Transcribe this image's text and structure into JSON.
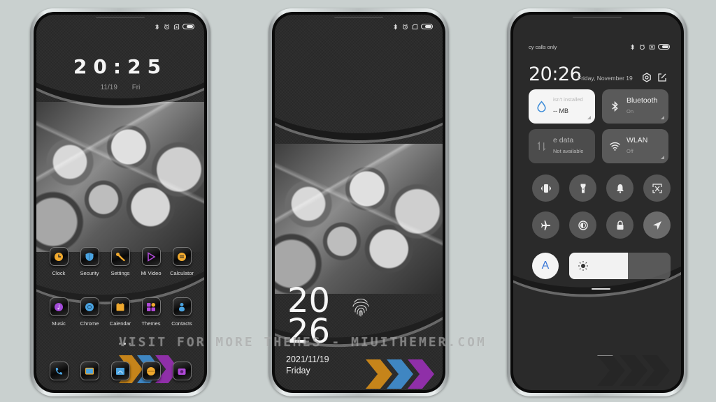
{
  "colors": {
    "background": "#c9d0cf",
    "chevron_orange": "#c6841a",
    "chevron_blue": "#3f86c2",
    "chevron_purple": "#8f2fa8",
    "accent_blue": "#3b78d8"
  },
  "watermark": "VISIT FOR MORE THEMES - MIUITHEMER.COM",
  "home_screen": {
    "status_icons": [
      "bluetooth-icon",
      "alarm-icon",
      "sim-icon",
      "battery-icon"
    ],
    "clock": "20:25",
    "date": "11/19",
    "weekday": "Fri",
    "apps_row1": [
      {
        "label": "Clock",
        "icon": "clock-icon",
        "color": "#f0a92e"
      },
      {
        "label": "Security",
        "icon": "shield-icon",
        "color": "#4aa3e0"
      },
      {
        "label": "Settings",
        "icon": "wrench-icon",
        "color": "#f0a92e"
      },
      {
        "label": "Mi Video",
        "icon": "play-icon",
        "color": "#b04ad8"
      },
      {
        "label": "Calculator",
        "icon": "calculator-icon",
        "color": "#f0a92e"
      }
    ],
    "apps_row2": [
      {
        "label": "Music",
        "icon": "music-icon",
        "color": "#a24ad8"
      },
      {
        "label": "Chrome",
        "icon": "chrome-icon",
        "color": "#4aa3e0"
      },
      {
        "label": "Calendar",
        "icon": "calendar-icon",
        "color": "#f0a92e"
      },
      {
        "label": "Themes",
        "icon": "themes-icon",
        "color": "#b04ad8"
      },
      {
        "label": "Contacts",
        "icon": "contacts-icon",
        "color": "#4aa3e0"
      }
    ],
    "dock": [
      {
        "icon": "phone-icon",
        "color": "#4aa3e0"
      },
      {
        "icon": "messages-icon",
        "color": "#f0a92e"
      },
      {
        "icon": "gallery-icon",
        "color": "#4aa3e0"
      },
      {
        "icon": "browser-icon",
        "color": "#f0a92e"
      },
      {
        "icon": "camera-icon",
        "color": "#b04ad8"
      }
    ],
    "page_count": 3,
    "active_page": 2
  },
  "lock_screen": {
    "status_icons": [
      "bluetooth-icon",
      "alarm-icon",
      "sim-icon",
      "battery-icon"
    ],
    "hour": "20",
    "minute": "26",
    "date": "2021/11/19",
    "weekday": "Friday"
  },
  "control_center": {
    "carrier_text": "cy calls only",
    "status_icons": [
      "bluetooth-icon",
      "alarm-icon",
      "sim-icon",
      "battery-icon"
    ],
    "clock": "20:26",
    "date": "Friday, November 19",
    "tiles": [
      {
        "title": "isn't installed",
        "subtitle": "-- MB",
        "icon": "water-drop-icon"
      },
      {
        "title": "Bluetooth",
        "subtitle": "On",
        "icon": "bluetooth-icon"
      },
      {
        "title": "e data",
        "subtitle": "Not available",
        "icon": "mobile-data-icon"
      },
      {
        "title": "WLAN",
        "subtitle": "Off",
        "icon": "wifi-icon"
      }
    ],
    "toggles": [
      {
        "name": "vibrate",
        "icon": "vibrate-icon"
      },
      {
        "name": "flashlight",
        "icon": "flashlight-icon"
      },
      {
        "name": "sound",
        "icon": "bell-icon"
      },
      {
        "name": "screenshot",
        "icon": "screenshot-icon"
      },
      {
        "name": "airplane",
        "icon": "airplane-icon"
      },
      {
        "name": "reading-mode",
        "icon": "contrast-icon"
      },
      {
        "name": "lock",
        "icon": "lock-icon"
      },
      {
        "name": "location",
        "icon": "location-icon"
      }
    ],
    "auto_brightness_label": "A",
    "brightness_percent": 58
  }
}
